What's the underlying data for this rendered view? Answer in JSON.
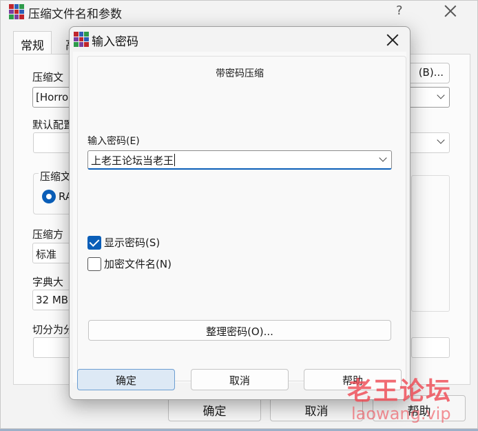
{
  "colors": {
    "accent": "#0a5eb8",
    "watermark": "#ee4a54",
    "icon_stack": [
      "#c0262c",
      "#2d5fb8",
      "#2e9b4b",
      "#7a3fa0"
    ]
  },
  "background_window": {
    "title": "压缩文件名和参数",
    "help_glyph": "?",
    "app_icon": "winrar-icon",
    "tabs": [
      "常规",
      "高"
    ],
    "archive_name_label": "压缩文",
    "archive_name_value": "[Horror",
    "browse_button": "(B)...",
    "profile_label": "默认配置",
    "format_group_label": "压缩文",
    "format_radio_label": "RA",
    "method_label": "压缩方",
    "method_value": "标准",
    "dictionary_label": "字典大",
    "dictionary_value": "32 MB",
    "split_label": "切分为分",
    "ok_button": "确定",
    "cancel_button": "取消",
    "help_button": "帮助"
  },
  "dialog": {
    "title": "输入密码",
    "heading": "带密码压缩",
    "password_label": "输入密码(E)",
    "password_value": "上老王论坛当老王",
    "show_password_label": "显示密码(S)",
    "show_password_checked": true,
    "encrypt_filenames_label": "加密文件名(N)",
    "encrypt_filenames_checked": false,
    "organize_button": "整理密码(O)...",
    "ok_button": "确定",
    "cancel_button": "取消",
    "help_button": "帮助"
  },
  "watermark": {
    "text": "老王论坛",
    "url": "laowang.vip"
  }
}
